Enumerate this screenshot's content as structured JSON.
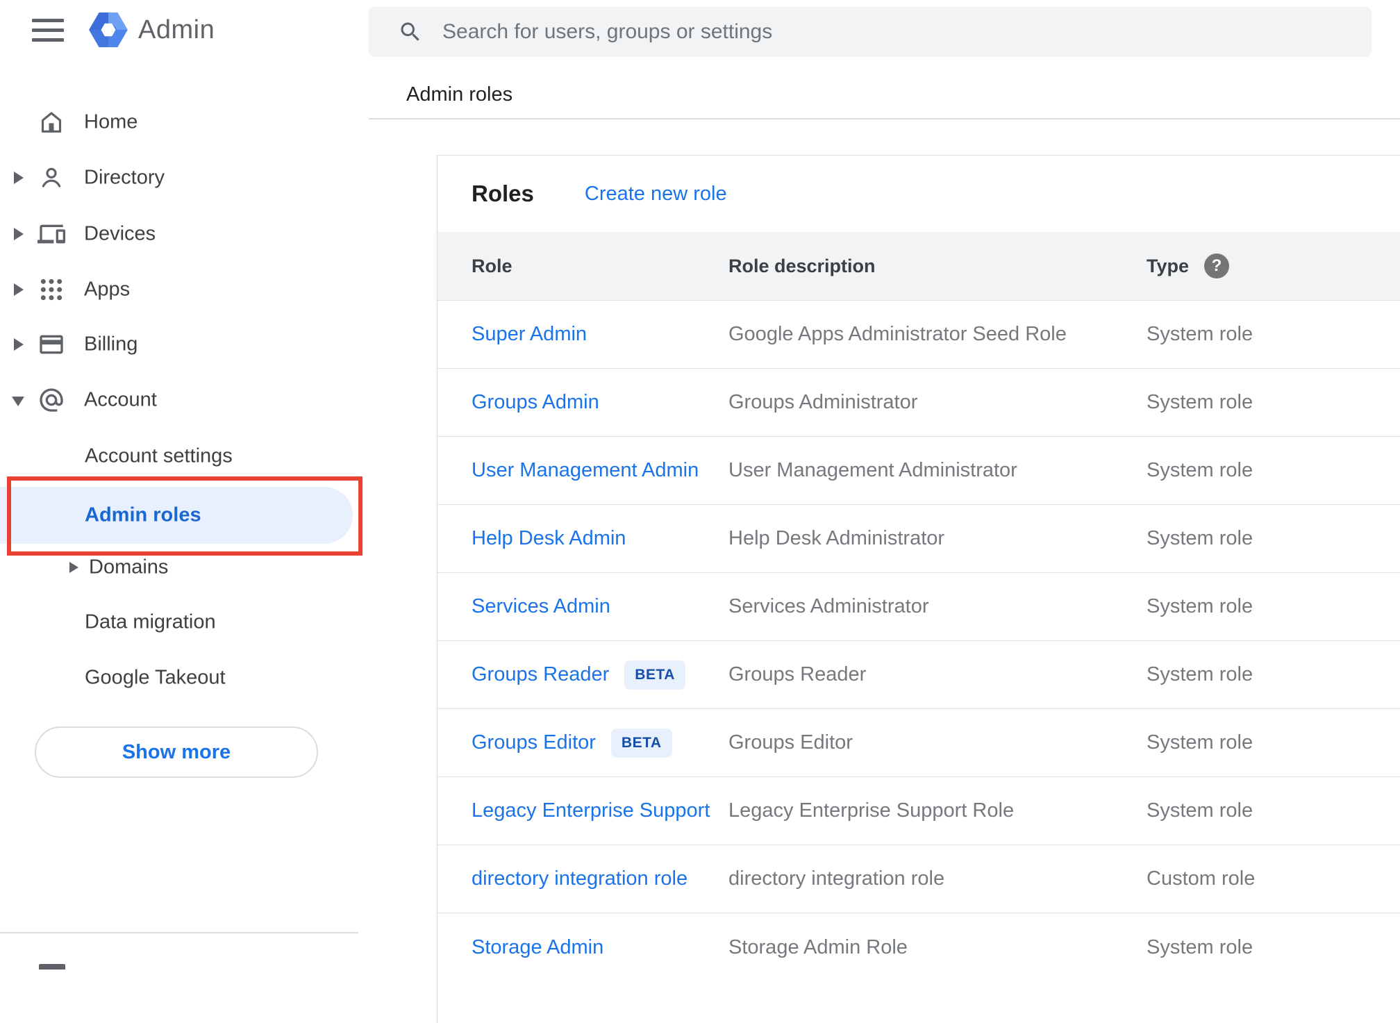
{
  "app": {
    "product_name": "Admin"
  },
  "topbar": {
    "search_placeholder": "Search for users, groups or settings"
  },
  "page": {
    "breadcrumb": "Admin roles"
  },
  "sidebar": {
    "items": [
      {
        "label": "Home"
      },
      {
        "label": "Directory"
      },
      {
        "label": "Devices"
      },
      {
        "label": "Apps"
      },
      {
        "label": "Billing"
      },
      {
        "label": "Account"
      }
    ],
    "account_children": [
      {
        "label": "Account settings"
      },
      {
        "label": "Admin roles"
      },
      {
        "label": "Domains"
      },
      {
        "label": "Data migration"
      },
      {
        "label": "Google Takeout"
      }
    ],
    "show_more_label": "Show more"
  },
  "roles_panel": {
    "title": "Roles",
    "create_link": "Create new role",
    "columns": {
      "role": "Role",
      "description": "Role description",
      "type": "Type"
    },
    "help_glyph": "?",
    "beta_label": "BETA",
    "rows": [
      {
        "role": "Super Admin",
        "description": "Google Apps Administrator Seed Role",
        "type": "System role"
      },
      {
        "role": "Groups Admin",
        "description": "Groups Administrator",
        "type": "System role"
      },
      {
        "role": "User Management Admin",
        "description": "User Management Administrator",
        "type": "System role"
      },
      {
        "role": "Help Desk Admin",
        "description": "Help Desk Administrator",
        "type": "System role"
      },
      {
        "role": "Services Admin",
        "description": "Services Administrator",
        "type": "System role"
      },
      {
        "role": "Groups Reader",
        "description": "Groups Reader",
        "type": "System role"
      },
      {
        "role": "Groups Editor",
        "description": "Groups Editor",
        "type": "System role"
      },
      {
        "role": "Legacy Enterprise Support",
        "description": "Legacy Enterprise Support Role",
        "type": "System role"
      },
      {
        "role": "directory integration role",
        "description": "directory integration role",
        "type": "Custom role"
      },
      {
        "role": "Storage Admin",
        "description": "Storage Admin Role",
        "type": "System role"
      }
    ]
  },
  "colors": {
    "link_blue": "#1a73e8",
    "active_item_blue": "#1967d2",
    "active_item_bg": "#e8f0fe",
    "annotation_red": "#e94235",
    "beta_bg": "#e8f0fe",
    "beta_text": "#174ea6",
    "table_header_bg": "#f1f3f4",
    "search_bg": "#f1f3f4",
    "icon_gray": "#5f6368",
    "text_dark": "#202124",
    "text_gray": "#75797e",
    "divider": "#e0e0e0"
  }
}
